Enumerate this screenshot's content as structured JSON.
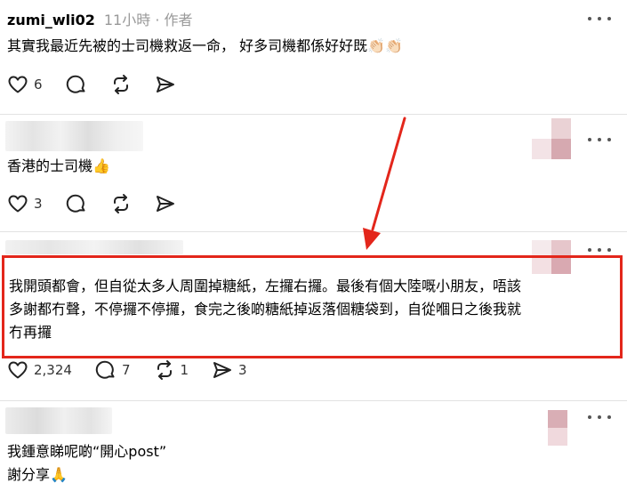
{
  "posts": [
    {
      "username": "zumi_wli02",
      "meta": "11小時 · 作者",
      "text": "其實我最近先被的士司機救返一命， 好多司機都係好好既👏🏻👏🏻",
      "actions": {
        "like": "6",
        "reply": "",
        "repost": "",
        "share": ""
      }
    },
    {
      "text": "香港的士司機👍",
      "actions": {
        "like": "3",
        "reply": "",
        "repost": "",
        "share": ""
      }
    },
    {
      "text_lines": [
        "我開頭都會，但自從太多人周圍掉糖紙，左攞右攞。最後有個大陸嘅小朋友，唔該",
        "多謝都冇聲，不停攞不停攞，食完之後啲糖紙掉返落個糖袋到，自從嗰日之後我就",
        "冇再攞"
      ],
      "actions": {
        "like": "2,324",
        "reply": "7",
        "repost": "1",
        "share": "3"
      }
    },
    {
      "text_lines": [
        "我鍾意睇呢啲“開心post”",
        "謝分享🙏"
      ]
    }
  ],
  "colors": {
    "highlight": "#e3261b",
    "text": "#000000",
    "meta": "#999999"
  }
}
